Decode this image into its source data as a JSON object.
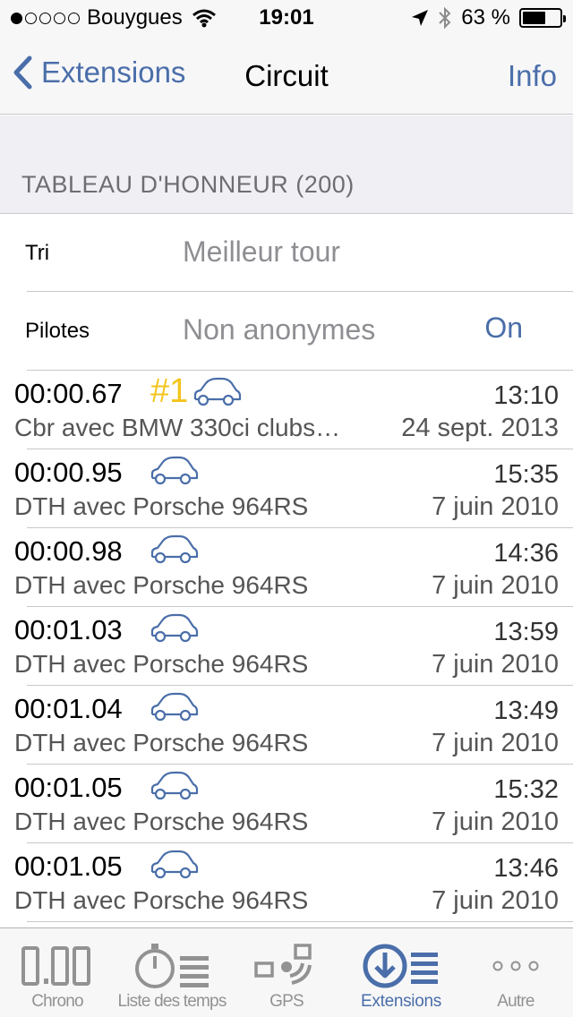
{
  "status_bar": {
    "carrier": "Bouygues",
    "time": "19:01",
    "battery": "63 %",
    "battery_level": 0.63
  },
  "nav": {
    "back_label": "Extensions",
    "title": "Circuit",
    "info_label": "Info"
  },
  "section": {
    "header": "TABLEAU D'HONNEUR (200)"
  },
  "settings": {
    "sort_label": "Tri",
    "sort_value": "Meilleur tour",
    "pilots_label": "Pilotes",
    "pilots_value": "Non anonymes",
    "pilots_toggle": "On"
  },
  "laps": [
    {
      "time": "00:00.67",
      "rank": "#1",
      "clock": "13:10",
      "desc": "Cbr avec BMW 330ci clubs…",
      "date": "24 sept. 2013"
    },
    {
      "time": "00:00.95",
      "rank": "",
      "clock": "15:35",
      "desc": "DTH avec Porsche 964RS",
      "date": "7 juin 2010"
    },
    {
      "time": "00:00.98",
      "rank": "",
      "clock": "14:36",
      "desc": "DTH avec Porsche 964RS",
      "date": "7 juin 2010"
    },
    {
      "time": "00:01.03",
      "rank": "",
      "clock": "13:59",
      "desc": "DTH avec Porsche 964RS",
      "date": "7 juin 2010"
    },
    {
      "time": "00:01.04",
      "rank": "",
      "clock": "13:49",
      "desc": "DTH avec Porsche 964RS",
      "date": "7 juin 2010"
    },
    {
      "time": "00:01.05",
      "rank": "",
      "clock": "15:32",
      "desc": "DTH avec Porsche 964RS",
      "date": "7 juin 2010"
    },
    {
      "time": "00:01.05",
      "rank": "",
      "clock": "13:46",
      "desc": "DTH avec Porsche 964RS",
      "date": "7 juin 2010"
    }
  ],
  "tabs": [
    {
      "label": "Chrono",
      "icon": "chrono-digits-icon"
    },
    {
      "label": "Liste des temps",
      "icon": "stopwatch-list-icon"
    },
    {
      "label": "GPS",
      "icon": "gps-icon"
    },
    {
      "label": "Extensions",
      "icon": "download-list-icon",
      "active": true
    },
    {
      "label": "Autre",
      "icon": "more-icon"
    }
  ],
  "colors": {
    "accent": "#4a6ea9",
    "rank_gold": "#f3c41c",
    "inactive_tab": "#929292"
  }
}
